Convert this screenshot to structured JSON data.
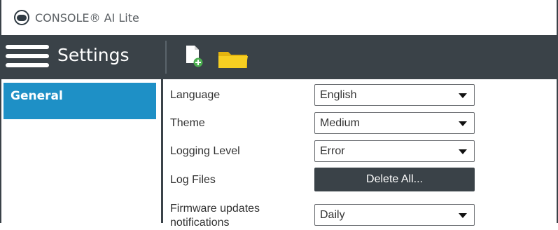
{
  "window": {
    "title": "CONSOLE® AI Lite"
  },
  "header": {
    "title": "Settings"
  },
  "sidebar": {
    "items": [
      {
        "label": "General"
      }
    ]
  },
  "settings": {
    "language": {
      "label": "Language",
      "value": "English"
    },
    "theme": {
      "label": "Theme",
      "value": "Medium"
    },
    "logging_level": {
      "label": "Logging Level",
      "value": "Error"
    },
    "log_files": {
      "label": "Log Files",
      "button_label": "Delete All..."
    },
    "firmware_updates": {
      "label": "Firmware updates notifications",
      "value": "Daily"
    }
  },
  "icons": {
    "app": "app-logo-icon",
    "menu": "hamburger-menu-icon",
    "new": "new-file-icon",
    "open": "folder-icon"
  },
  "colors": {
    "toolbar": "#3a4248",
    "accent": "#1e90c6",
    "folder": "#f2c811",
    "add_badge": "#4caf50"
  }
}
